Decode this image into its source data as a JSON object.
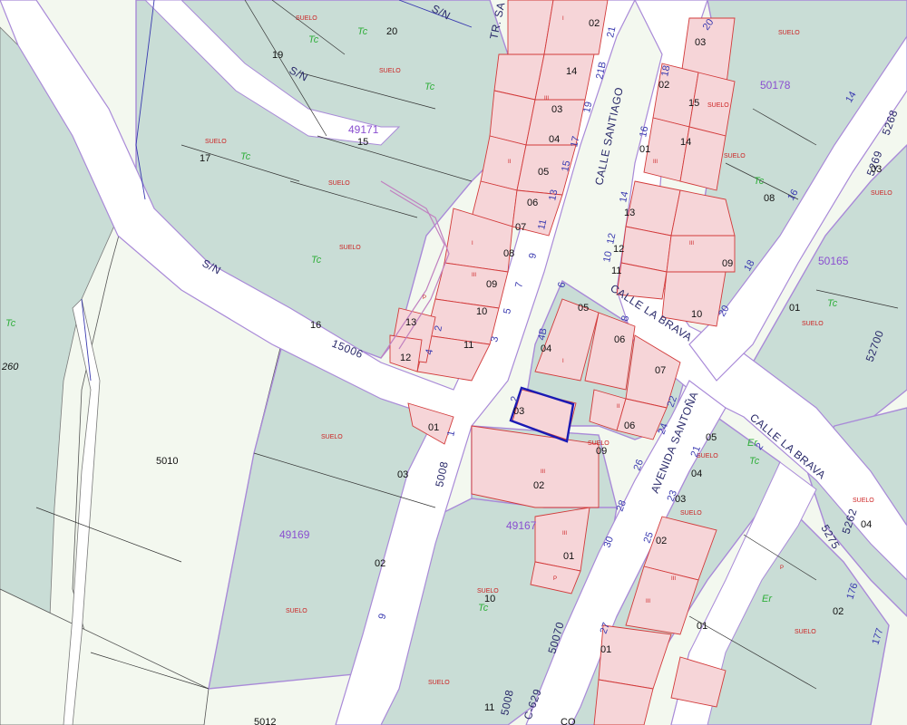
{
  "streets": {
    "tr_santiago": "TR. SA",
    "sn_top": "S/N",
    "sn_mid": "S/N",
    "sn_left": "S/N",
    "calle_santiago": "CALLE SANTIAGO",
    "calle_la_brava": "CALLE LA BRAVA",
    "calle_la_brava_2": "CALLE LA BRAVA",
    "avenida_santona": "AVENIDA SANTOÑA",
    "road_15006": "15006",
    "road_5008": "5008",
    "road_5008_b": "5008",
    "road_50070": "50070",
    "road_c629": "C-629",
    "road_5262": "5262",
    "road_5275": "5275",
    "road_52700": "52700",
    "road_5269": "5269",
    "road_5268": "5268"
  },
  "blocks": {
    "b49171": "49171",
    "b50178": "50178",
    "b50165": "50165",
    "b49169": "49169",
    "b49167": "49167",
    "b5010": "5010",
    "b5012": "5012"
  },
  "parcels": {
    "p19": "19",
    "p20": "20",
    "p17": "17",
    "p15": "15",
    "p16": "16",
    "p02a": "02",
    "p14": "14",
    "p03a": "03",
    "p04a": "04",
    "p05a": "05",
    "p06a": "06",
    "p07a": "07",
    "p08a": "08",
    "p09a": "09",
    "p10a": "10",
    "p11a": "11",
    "p12a": "12",
    "p13a": "13",
    "p01a": "01",
    "p03b": "03",
    "p02b": "02",
    "p03c": "03",
    "p02c": "02",
    "p15b": "15",
    "p14b": "14",
    "p01c": "01",
    "p13b": "13",
    "p12b": "12",
    "p11b": "11",
    "p09b": "09",
    "p10b": "10",
    "p08b": "08",
    "p03d": "03",
    "p01d": "01",
    "p05b": "05",
    "p04b": "04",
    "p06b": "06",
    "p07b": "07",
    "p06c": "06",
    "p03e": "03",
    "p09c": "09",
    "p02d": "02",
    "p01e": "01",
    "p10c": "10",
    "p11c": "11",
    "p05c": "05",
    "p04c": "04",
    "p03f": "03",
    "p02e": "02",
    "p01f": "01",
    "p04d": "04",
    "p02f": "02",
    "p01g": "01",
    "p260": "260",
    "pCO": "CO"
  },
  "uses": {
    "u_tc1": "Tc",
    "u_tc2": "Tc",
    "u_tc3": "Tc",
    "u_tc4": "Tc",
    "u_tc5": "Tc",
    "u_tc6": "Tc",
    "u_tc7": "Tc",
    "u_tc8": "Tc",
    "u_tc9": "Tc",
    "u_tc10": "Tc",
    "u_tc11": "Tc",
    "u_er1": "Er",
    "u_er2": "Er",
    "u_suelo": "SUELO"
  },
  "house_numbers": {
    "h02": "02",
    "h21": "21",
    "h21b": "21B",
    "h19": "19",
    "h17": "17",
    "h15": "15",
    "h13": "13",
    "h11": "11",
    "h9": "9",
    "h7": "7",
    "h5": "5",
    "h3": "3",
    "h4": "4",
    "h2": "2",
    "h20": "20",
    "h18": "18",
    "h16": "16",
    "h14": "14",
    "h12": "12",
    "h10": "10",
    "h6": "6",
    "h4b": "4B",
    "h8": "8",
    "h2b": "2",
    "h1": "1",
    "h22": "22",
    "h24": "24",
    "h26": "26",
    "h28": "28",
    "h30": "30",
    "h27": "27",
    "h25": "25",
    "h23": "23",
    "h21c": "21",
    "h2c": "2",
    "h14b": "14",
    "h16b": "16",
    "h18b": "18",
    "h20b": "20",
    "h9b": "9",
    "h176": "176",
    "h177": "177"
  },
  "colors": {
    "urban_parcel": "#c9ddd6",
    "building": "#f6d5d8",
    "rustic_parcel": "#f3f8ef",
    "road": "#ffffff",
    "block_boundary": "#a98ad8",
    "building_line": "#d23a3a",
    "selected_parcel": "#1a1ab4"
  }
}
